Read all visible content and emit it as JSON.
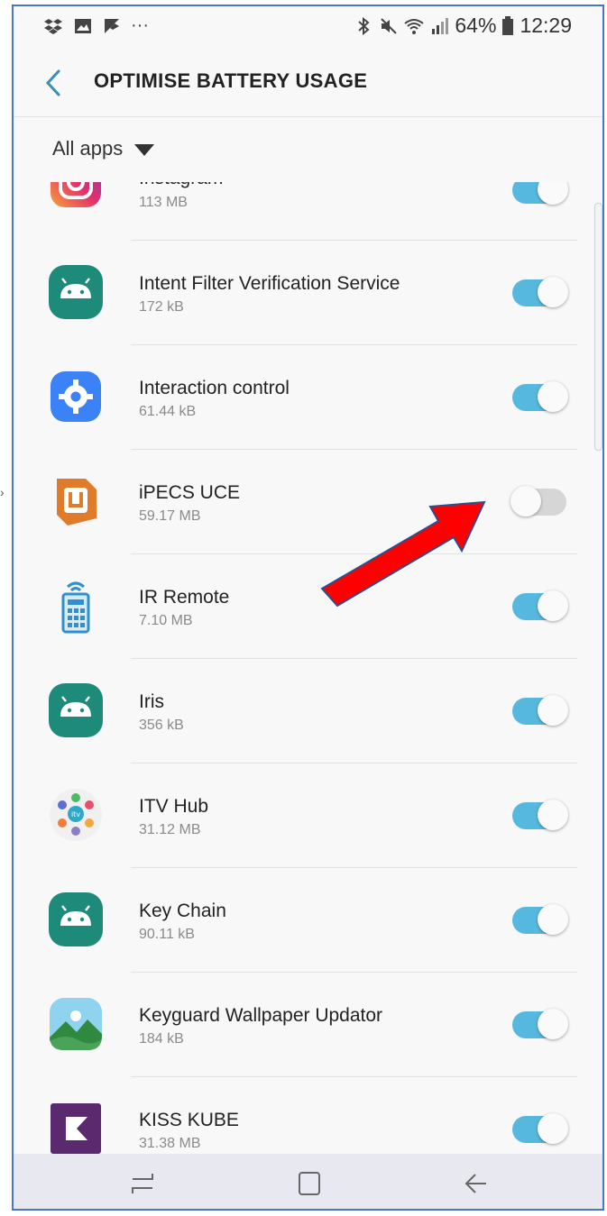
{
  "status_bar": {
    "left_icons": [
      "dropbox-icon",
      "gallery-icon",
      "flipboard-icon",
      "more-dots-icon"
    ],
    "more_label": "···",
    "right_icons": [
      "bluetooth-icon",
      "mute-icon",
      "wifi-icon",
      "signal-icon"
    ],
    "battery": "64%",
    "time": "12:29"
  },
  "header": {
    "back_icon": "chevron-left-icon",
    "title": "OPTIMISE BATTERY USAGE"
  },
  "filter": {
    "label": "All apps",
    "icon": "dropdown-triangle-icon"
  },
  "apps": [
    {
      "name": "Instagram",
      "size": "113 MB",
      "enabled": true,
      "icon": "instagram-icon",
      "color": "#e1306c"
    },
    {
      "name": "Intent Filter Verification Service",
      "size": "172 kB",
      "enabled": true,
      "icon": "android-icon",
      "color": "#1e8a7a"
    },
    {
      "name": "Interaction control",
      "size": "61.44 kB",
      "enabled": true,
      "icon": "settings-gear-icon",
      "color": "#3b82f6"
    },
    {
      "name": "iPECS UCE",
      "size": "59.17 MB",
      "enabled": false,
      "icon": "ipecs-icon",
      "color": "#e07b29"
    },
    {
      "name": "IR Remote",
      "size": "7.10 MB",
      "enabled": true,
      "icon": "remote-control-icon",
      "color": "#2f8fcf"
    },
    {
      "name": "Iris",
      "size": "356 kB",
      "enabled": true,
      "icon": "android-icon",
      "color": "#1e8a7a"
    },
    {
      "name": "ITV Hub",
      "size": "31.12 MB",
      "enabled": true,
      "icon": "itv-hub-icon",
      "color": "#3ab0a0"
    },
    {
      "name": "Key Chain",
      "size": "90.11 kB",
      "enabled": true,
      "icon": "android-icon",
      "color": "#1e8a7a"
    },
    {
      "name": "Keyguard Wallpaper Updator",
      "size": "184 kB",
      "enabled": true,
      "icon": "landscape-wallpaper-icon",
      "color": "#4ba35a"
    },
    {
      "name": "KISS KUBE",
      "size": "31.38 MB",
      "enabled": true,
      "icon": "kiss-kube-icon",
      "color": "#5b2a6e"
    }
  ],
  "nav_bar": {
    "recents_icon": "recents-icon",
    "home_icon": "home-icon",
    "back_icon": "back-arrow-icon"
  },
  "colors": {
    "toggle_on": "#57b8df",
    "toggle_off": "#d6d6d6",
    "annotation_arrow": "#ff0000",
    "frame_border": "#4a77bf"
  },
  "annotation": {
    "icon": "red-arrow-pointer-icon",
    "target": "iPECS UCE toggle"
  }
}
